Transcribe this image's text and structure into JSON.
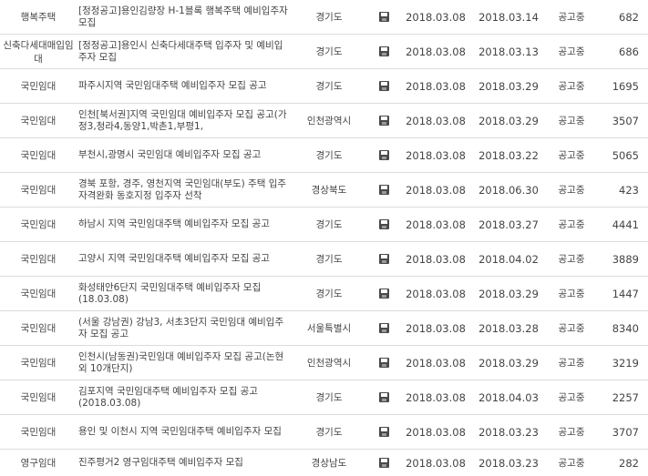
{
  "rows": [
    {
      "type": "행복주택",
      "title": "[정정공고]용인김량장 H-1블록 행복주택 예비입주자 모집",
      "region": "경기도",
      "file_icon": "disk-icon",
      "start": "2018.03.08",
      "end": "2018.03.14",
      "status": "공고중",
      "views": "682"
    },
    {
      "type": "신축다세대매입임대",
      "title": "[정정공고]용인시 신축다세대주택 입주자 및 예비입주자 모집",
      "region": "경기도",
      "file_icon": "disk-icon",
      "start": "2018.03.08",
      "end": "2018.03.13",
      "status": "공고중",
      "views": "686"
    },
    {
      "type": "국민임대",
      "title": "파주시지역 국민임대주택 예비입주자 모집 공고",
      "region": "경기도",
      "file_icon": "disk-icon",
      "start": "2018.03.08",
      "end": "2018.03.29",
      "status": "공고중",
      "views": "1695"
    },
    {
      "type": "국민임대",
      "title": "인천[북서권]지역 국민임대 예비입주자 모집 공고(가정3,청라4,동양1,박촌1,부평1,",
      "region": "인천광역시",
      "file_icon": "disk-icon",
      "start": "2018.03.08",
      "end": "2018.03.29",
      "status": "공고중",
      "views": "3507"
    },
    {
      "type": "국민임대",
      "title": "부천시,광명시 국민임대 예비입주자 모집 공고",
      "region": "경기도",
      "file_icon": "disk-icon",
      "start": "2018.03.08",
      "end": "2018.03.22",
      "status": "공고중",
      "views": "5065"
    },
    {
      "type": "국민임대",
      "title": "경북 포항, 경주, 영천지역 국민임대(부도) 주택 입주자격완화 동호지정 입주자 선착",
      "region": "경상북도",
      "file_icon": "disk-icon",
      "start": "2018.03.08",
      "end": "2018.06.30",
      "status": "공고중",
      "views": "423"
    },
    {
      "type": "국민임대",
      "title": "하남시 지역 국민임대주택 예비입주자 모집 공고",
      "region": "경기도",
      "file_icon": "disk-icon",
      "start": "2018.03.08",
      "end": "2018.03.27",
      "status": "공고중",
      "views": "4441"
    },
    {
      "type": "국민임대",
      "title": "고양시 지역 국민임대주택 예비입주자 모집 공고",
      "region": "경기도",
      "file_icon": "disk-icon",
      "start": "2018.03.08",
      "end": "2018.04.02",
      "status": "공고중",
      "views": "3889"
    },
    {
      "type": "국민임대",
      "title": "화성태안6단지 국민임대주택 예비입주자 모집(18.03.08)",
      "region": "경기도",
      "file_icon": "disk-icon",
      "start": "2018.03.08",
      "end": "2018.03.29",
      "status": "공고중",
      "views": "1447"
    },
    {
      "type": "국민임대",
      "title": "(서울 강남권) 강남3, 서초3단지 국민임대 예비입주자 모집 공고",
      "region": "서울특별시",
      "file_icon": "disk-icon",
      "start": "2018.03.08",
      "end": "2018.03.28",
      "status": "공고중",
      "views": "8340"
    },
    {
      "type": "국민임대",
      "title": "인천시(남동권)국민임대 예비입주자 모집 공고(논현외 10개단지)",
      "region": "인천광역시",
      "file_icon": "disk-icon",
      "start": "2018.03.08",
      "end": "2018.03.29",
      "status": "공고중",
      "views": "3219"
    },
    {
      "type": "국민임대",
      "title": "김포지역 국민임대주택 예비입주자 모집 공고(2018.03.08)",
      "region": "경기도",
      "file_icon": "disk-icon",
      "start": "2018.03.08",
      "end": "2018.04.03",
      "status": "공고중",
      "views": "2257"
    },
    {
      "type": "국민임대",
      "title": "용인 및 이천시 지역 국민임대주택 예비입주자 모집",
      "region": "경기도",
      "file_icon": "disk-icon",
      "start": "2018.03.08",
      "end": "2018.03.23",
      "status": "공고중",
      "views": "3707"
    },
    {
      "type": "영구임대",
      "title": "진주평거2 영구임대주택 예비입주자 모집",
      "region": "경상남도",
      "file_icon": "disk-icon",
      "start": "2018.03.08",
      "end": "2018.03.23",
      "status": "공고중",
      "views": "282"
    }
  ]
}
